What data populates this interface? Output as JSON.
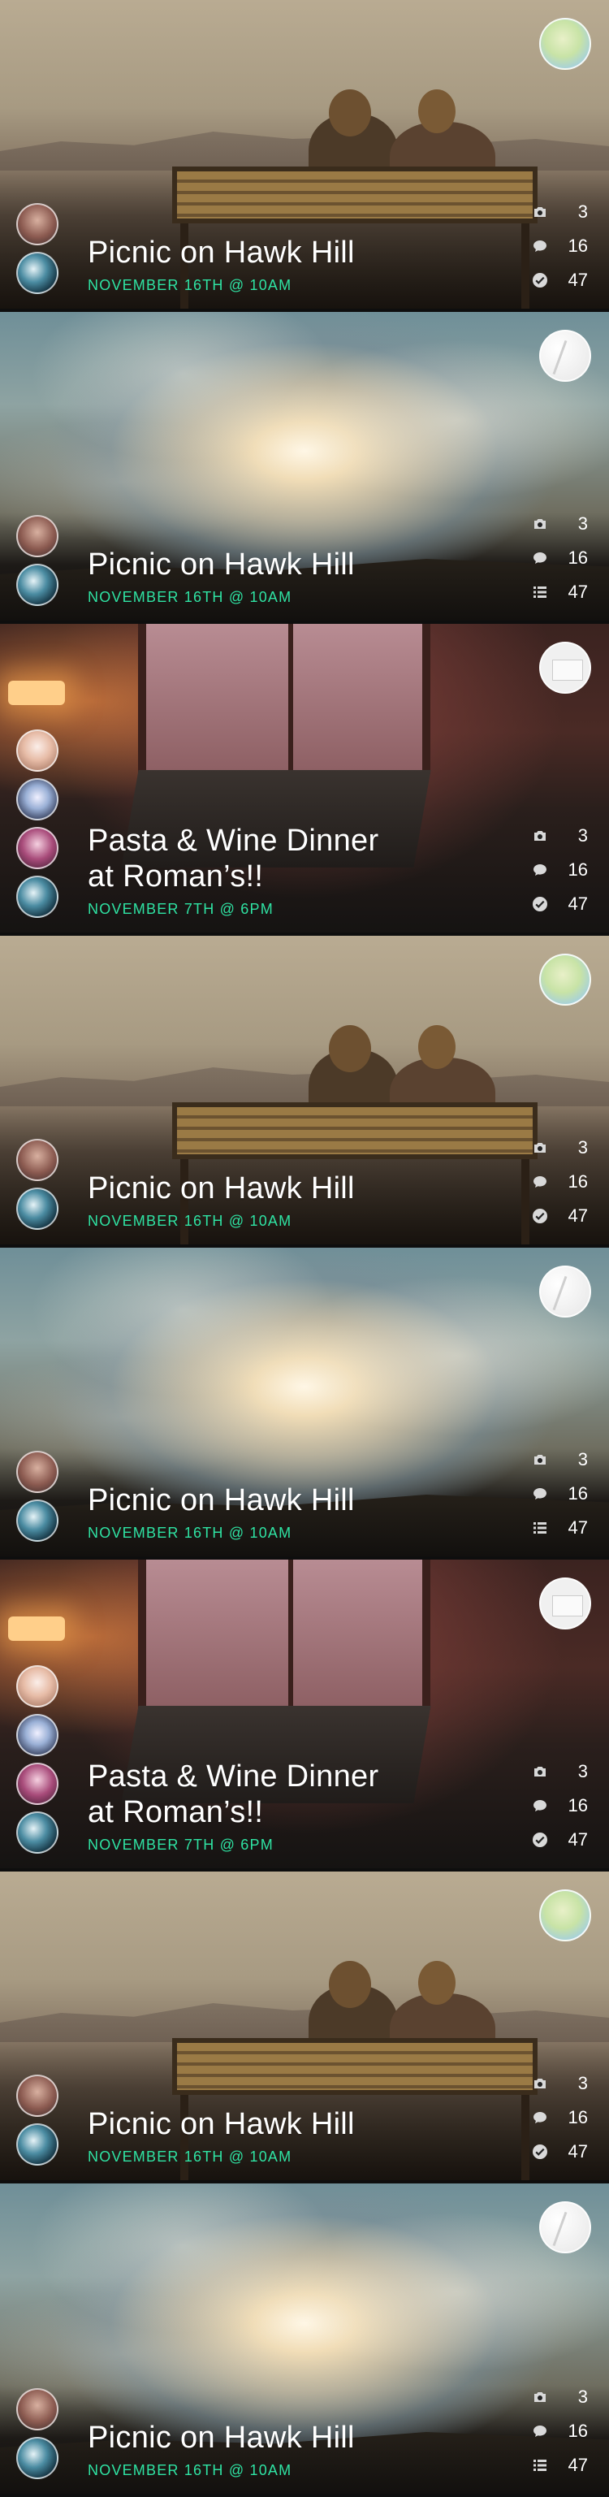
{
  "feed": {
    "cards": [
      {
        "title_line1": "Picnic on Hawk Hill",
        "title_line2": "",
        "date": "NOVEMBER 16TH @ 10AM",
        "photos": "3",
        "comments": "16",
        "rsvps": "47",
        "bottom_icon": "check-circle-icon",
        "scene": "bench",
        "host": "green"
      },
      {
        "title_line1": "Picnic on Hawk Hill",
        "title_line2": "",
        "date": "NOVEMBER 16TH @ 10AM",
        "photos": "3",
        "comments": "16",
        "rsvps": "47",
        "bottom_icon": "list-icon",
        "scene": "sky",
        "host": "white"
      },
      {
        "title_line1": "Pasta & Wine Dinner",
        "title_line2": "at Roman’s!!",
        "date": "NOVEMBER 7TH @ 6PM",
        "photos": "3",
        "comments": "16",
        "rsvps": "47",
        "bottom_icon": "check-circle-icon",
        "scene": "dinner",
        "host": "note"
      },
      {
        "title_line1": "Picnic on Hawk Hill",
        "title_line2": "",
        "date": "NOVEMBER 16TH @ 10AM",
        "photos": "3",
        "comments": "16",
        "rsvps": "47",
        "bottom_icon": "check-circle-icon",
        "scene": "bench",
        "host": "green"
      },
      {
        "title_line1": "Picnic on Hawk Hill",
        "title_line2": "",
        "date": "NOVEMBER 16TH @ 10AM",
        "photos": "3",
        "comments": "16",
        "rsvps": "47",
        "bottom_icon": "list-icon",
        "scene": "sky",
        "host": "white"
      },
      {
        "title_line1": "Pasta & Wine Dinner",
        "title_line2": "at Roman’s!!",
        "date": "NOVEMBER 7TH @ 6PM",
        "photos": "3",
        "comments": "16",
        "rsvps": "47",
        "bottom_icon": "check-circle-icon",
        "scene": "dinner",
        "host": "note"
      },
      {
        "title_line1": "Picnic on Hawk Hill",
        "title_line2": "",
        "date": "NOVEMBER 16TH @ 10AM",
        "photos": "3",
        "comments": "16",
        "rsvps": "47",
        "bottom_icon": "check-circle-icon",
        "scene": "bench",
        "host": "green"
      },
      {
        "title_line1": "Picnic on Hawk Hill",
        "title_line2": "",
        "date": "NOVEMBER 16TH @ 10AM",
        "photos": "3",
        "comments": "16",
        "rsvps": "47",
        "bottom_icon": "list-icon",
        "scene": "sky",
        "host": "white"
      }
    ]
  },
  "colors": {
    "date_accent": "#2fe3a3",
    "text": "#ffffff"
  },
  "icons": {
    "photos": "camera-icon",
    "comments": "comment-bubble-icon"
  }
}
